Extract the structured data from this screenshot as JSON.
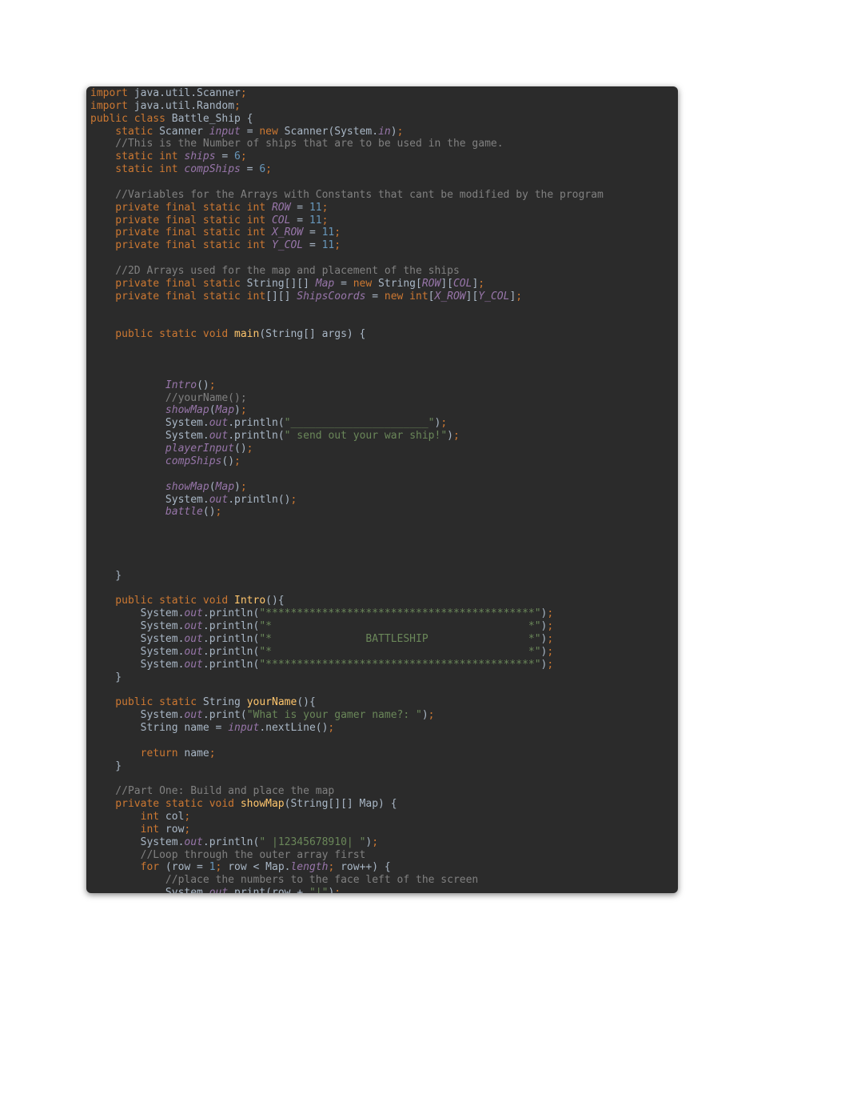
{
  "code": {
    "l1_kw_import": "import",
    "l1_rest": " java.util.Scanner",
    "l2_kw_import": "import",
    "l2_rest": " java.util.Random",
    "l3_kw_pub": "public class",
    "l3_cls": " Battle_Ship {",
    "l4_kw": "    static",
    "l4_type": " Scanner ",
    "l4_fld": "input",
    "l4_eq": " = ",
    "l4_new": "new",
    "l4_rest": " Scanner(System.",
    "l4_in": "in",
    "l4_close": ")",
    "cmt_ships": "    //This is the Number of ships that are to be used in the game.",
    "ships_kw": "    static int ",
    "ships_fld": "ships",
    "ships_eq": " = ",
    "ships_num": "6",
    "comp_kw": "    static int ",
    "comp_fld": "compShips",
    "comp_eq": " = ",
    "comp_num": "6",
    "cmt_vars": "    //Variables for the Arrays with Constants that cant be modified by the program",
    "row_kw": "    private final static int ",
    "row_fld": "ROW",
    "row_eq": " = ",
    "row_num": "11",
    "col_kw": "    private final static int ",
    "col_fld": "COL",
    "col_eq": " = ",
    "col_num": "11",
    "xrow_kw": "    private final static int ",
    "xrow_fld": "X_ROW",
    "xrow_eq": " = ",
    "xrow_num": "11",
    "ycol_kw": "    private final static int ",
    "ycol_fld": "Y_COL",
    "ycol_eq": " = ",
    "ycol_num": "11",
    "cmt_2d": "    //2D Arrays used for the map and placement of the ships",
    "map_kw": "    private final static",
    "map_type": " String[][] ",
    "map_fld": "Map",
    "map_eq": " = ",
    "map_new": "new",
    "map_rest": " String[",
    "map_row": "ROW",
    "map_mid": "][",
    "map_col": "COL",
    "map_end": "]",
    "sc_kw": "    private final static int",
    "sc_type": "[][] ",
    "sc_fld": "ShipsCoords",
    "sc_eq": " = ",
    "sc_new": "new int",
    "sc_open": "[",
    "sc_xrow": "X_ROW",
    "sc_mid": "][",
    "sc_ycol": "Y_COL",
    "sc_end": "]",
    "main_kw": "    public static void ",
    "main_name": "main",
    "main_sig": "(String[] args) {",
    "call_intro": "            Intro",
    "call_intro_paren": "()",
    "cmt_yourname": "            //yourName();",
    "call_showmap1_a": "            showMap",
    "call_showmap1_b": "(",
    "call_showmap1_c": "Map",
    "call_showmap1_d": ")",
    "call_sopln_pre": "            System.",
    "out_tok": "out",
    "println_open": ".println(",
    "str_under": "\"______________________\"",
    "close_paren": ")",
    "str_send": "\" send out your war ship!\"",
    "call_playerInput_a": "            playerInput",
    "call_playerInput_b": "()",
    "call_compShips_a": "            compShips",
    "call_compShips_b": "()",
    "call_showmap2_a": "            showMap",
    "call_showmap2_b": "(",
    "call_showmap2_c": "Map",
    "call_showmap2_d": ")",
    "println_empty": ".println()",
    "call_battle_a": "            battle",
    "call_battle_b": "()",
    "brace_close1": "    }",
    "intro_kw": "    public static void ",
    "intro_name": "Intro",
    "intro_sig": "(){",
    "sout_pre": "        System.",
    "star_line": "\"*******************************************\"",
    "star_pad": "\"*                                         *\"",
    "star_bat": "\"*               BATTLESHIP                *\"",
    "brace_close2": "    }",
    "yn_kw": "    public static",
    "yn_type": " String ",
    "yn_name": "yourName",
    "yn_sig": "(){",
    "yn_print_open": ".print(",
    "yn_str": "\"What is your gamer name?: \"",
    "yn_name_decl": "        String name = ",
    "yn_input": "input",
    "yn_next": ".nextLine()",
    "return_kw": "        return",
    "return_name": " name",
    "brace_close3": "    }",
    "cmt_part1": "    //Part One: Build and place the map",
    "sm_kw": "    private static void ",
    "sm_name": "showMap",
    "sm_sig": "(String[][] Map) {",
    "int_col_kw": "        int",
    "int_col": " col",
    "int_row_kw": "        int",
    "int_row": " row",
    "sm_print_pre": "        System.",
    "sm_str_hdr": "\" |12345678910| \"",
    "cmt_loop": "        //Loop through the outer array first",
    "for_kw": "        for",
    "for_open": " (row = ",
    "for_one": "1",
    "for_mid1": " row < Map.",
    "for_len": "length",
    "for_mid2": " row++) {",
    "cmt_place": "            //place the numbers to the face left of the screen",
    "sm_inner_pre": "            System.",
    "print_open": ".print(row + ",
    "pipe_str": "\"|\"",
    "semi": ";"
  }
}
